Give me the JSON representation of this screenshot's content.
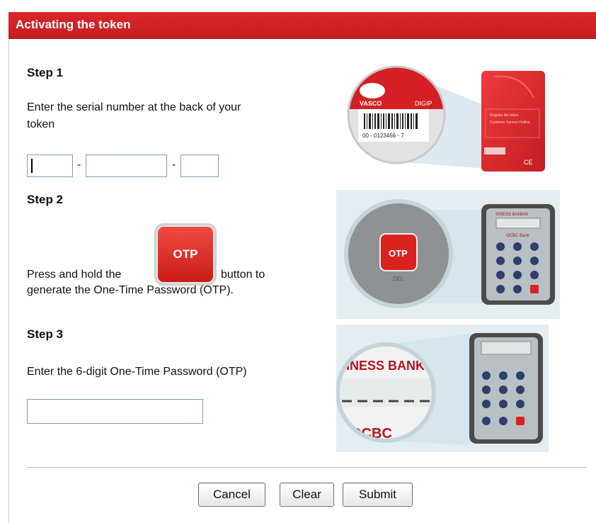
{
  "header": {
    "title": "Activating the token"
  },
  "step1": {
    "title": "Step 1",
    "instruction_line1": "Enter the serial number at the back of your",
    "instruction_line2": "token",
    "separator": "-",
    "card_brand": "VASCO",
    "card_brand_partial": "DIGIP",
    "serial_example": "00 - 0123456 - 7"
  },
  "step2": {
    "title": "Step 2",
    "instruction_before": "Press and hold the",
    "instruction_after": "button to",
    "instruction_line2": "generate the One-Time Password (OTP).",
    "otp_label": "OTP",
    "token_header": "SINESS BANKIN",
    "bank_logo": "OCBC Bank",
    "del_label": "DEL"
  },
  "step3": {
    "title": "Step 3",
    "instruction": "Enter the 6-digit One-Time Password (OTP)",
    "token_header": "SINESS BANKI",
    "token_footer": "OCBC"
  },
  "actions": {
    "cancel": "Cancel",
    "clear": "Clear",
    "submit": "Submit"
  },
  "colors": {
    "header_red": "#d2232a",
    "border": "#7f9db9"
  }
}
